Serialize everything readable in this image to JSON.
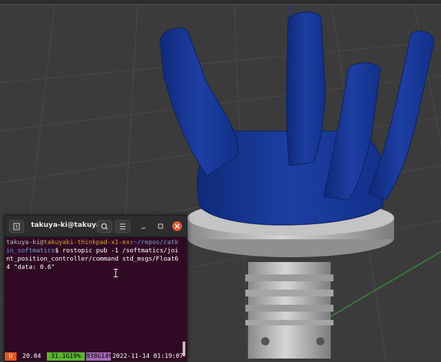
{
  "viewport": {
    "label": "3D robot gripper model view",
    "colors": {
      "background": "#3b3b3b",
      "gripper_blue": "#1a3a9a",
      "base_gray": "#c8c8c8",
      "axis_green": "#3a8a3a",
      "axis_blue": "#2030d0"
    }
  },
  "terminal": {
    "title": "takuya-ki@takuya...",
    "icons": {
      "new_tab": "new-tab-icon",
      "search": "search-icon",
      "menu": "hamburger-menu-icon",
      "minimize": "minimize-icon",
      "maximize": "maximize-icon",
      "close": "close-icon"
    },
    "prompt_user": "takuya-ki",
    "prompt_at": "@",
    "prompt_host": "takuyaki-thinkpad-x1-ex",
    "prompt_colon": ":",
    "prompt_path_line1": "~/repos/catk",
    "prompt_path_line2": "in_softmatics",
    "prompt_dollar": "$ ",
    "command_line2": "rostopic pub -1 /softmatics/joi",
    "command_line3": "nt_position_controller/command std_msgs/Float6",
    "command_line4": "4 \"data: 0.6\"",
    "status": {
      "os": "U",
      "version": "20.04",
      "cpu": "31.1G19%",
      "mem": "938G14%",
      "datetime": "2022-11-14 01:19:07"
    },
    "colors": {
      "background": "#300a24",
      "host": "#d6a52a",
      "path": "#6aa2d8",
      "cpu": "#5bb62e",
      "mem": "#a568b8",
      "os": "#e95420"
    }
  }
}
